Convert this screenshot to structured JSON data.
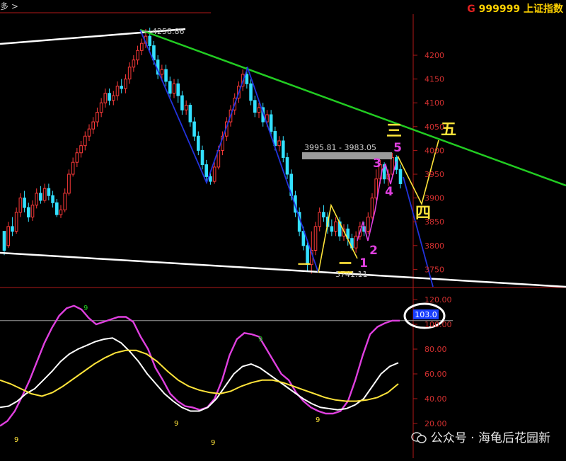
{
  "header": {
    "left_fragment": "多 >",
    "right_flag": "G",
    "code": "999999",
    "name": "上证指数"
  },
  "watermark": "公众号 · 海龟后花园新",
  "colors": {
    "up": "#ff3a3a",
    "down": "#33e0ff",
    "trend_green": "#22cc22",
    "trend_white": "#ffffff",
    "wave_blue": "#2233dd",
    "wave_yellow": "#ffe43a",
    "wave_magenta": "#e040e0",
    "axis_red": "#b01818"
  },
  "chart_data": [
    {
      "type": "candlestick",
      "title": "",
      "y_ticks": [
        3750,
        3800,
        3850,
        3900,
        3950,
        4000,
        4050,
        4100,
        4150,
        4200
      ],
      "ylim": [
        3705,
        4255
      ],
      "high_label": "4258.86",
      "low_label": "3741.11",
      "range_label": "3995.81 - 3983.05",
      "candles": [
        [
          3830,
          3790,
          3830,
          3780
        ],
        [
          3800,
          3840,
          3850,
          3795
        ],
        [
          3840,
          3830,
          3860,
          3820
        ],
        [
          3830,
          3870,
          3880,
          3825
        ],
        [
          3870,
          3900,
          3910,
          3860
        ],
        [
          3900,
          3880,
          3915,
          3870
        ],
        [
          3880,
          3860,
          3890,
          3850
        ],
        [
          3860,
          3885,
          3895,
          3852
        ],
        [
          3885,
          3910,
          3920,
          3878
        ],
        [
          3910,
          3895,
          3925,
          3888
        ],
        [
          3895,
          3920,
          3930,
          3890
        ],
        [
          3920,
          3905,
          3930,
          3895
        ],
        [
          3905,
          3890,
          3915,
          3880
        ],
        [
          3890,
          3865,
          3898,
          3860
        ],
        [
          3865,
          3875,
          3885,
          3858
        ],
        [
          3875,
          3910,
          3920,
          3870
        ],
        [
          3910,
          3950,
          3960,
          3905
        ],
        [
          3950,
          3975,
          3985,
          3945
        ],
        [
          3975,
          3995,
          4005,
          3965
        ],
        [
          3995,
          4010,
          4020,
          3985
        ],
        [
          4010,
          4030,
          4040,
          4000
        ],
        [
          4030,
          4045,
          4055,
          4020
        ],
        [
          4045,
          4060,
          4070,
          4035
        ],
        [
          4060,
          4080,
          4090,
          4050
        ],
        [
          4080,
          4100,
          4110,
          4070
        ],
        [
          4100,
          4120,
          4130,
          4090
        ],
        [
          4120,
          4105,
          4130,
          4095
        ],
        [
          4105,
          4115,
          4125,
          4095
        ],
        [
          4115,
          4135,
          4145,
          4105
        ],
        [
          4135,
          4130,
          4150,
          4120
        ],
        [
          4130,
          4150,
          4160,
          4120
        ],
        [
          4150,
          4175,
          4185,
          4140
        ],
        [
          4175,
          4190,
          4200,
          4165
        ],
        [
          4190,
          4210,
          4220,
          4180
        ],
        [
          4210,
          4225,
          4235,
          4200
        ],
        [
          4225,
          4240,
          4255,
          4215
        ],
        [
          4240,
          4220,
          4258,
          4210
        ],
        [
          4220,
          4190,
          4230,
          4180
        ],
        [
          4190,
          4160,
          4200,
          4150
        ],
        [
          4160,
          4170,
          4180,
          4145
        ],
        [
          4170,
          4145,
          4180,
          4135
        ],
        [
          4145,
          4120,
          4155,
          4110
        ],
        [
          4120,
          4140,
          4150,
          4110
        ],
        [
          4140,
          4115,
          4150,
          4100
        ],
        [
          4115,
          4085,
          4125,
          4075
        ],
        [
          4085,
          4095,
          4105,
          4075
        ],
        [
          4095,
          4060,
          4100,
          4050
        ],
        [
          4060,
          4030,
          4070,
          4020
        ],
        [
          4030,
          4000,
          4040,
          3990
        ],
        [
          4000,
          3970,
          4010,
          3960
        ],
        [
          3970,
          3945,
          3980,
          3935
        ],
        [
          3945,
          3935,
          3955,
          3928
        ],
        [
          3935,
          3965,
          3975,
          3930
        ],
        [
          3965,
          4000,
          4010,
          3960
        ],
        [
          4000,
          4030,
          4040,
          3990
        ],
        [
          4030,
          4060,
          4070,
          4020
        ],
        [
          4060,
          4085,
          4095,
          4050
        ],
        [
          4085,
          4110,
          4120,
          4075
        ],
        [
          4110,
          4135,
          4145,
          4100
        ],
        [
          4135,
          4160,
          4170,
          4125
        ],
        [
          4160,
          4140,
          4175,
          4130
        ],
        [
          4140,
          4105,
          4150,
          4095
        ],
        [
          4105,
          4080,
          4115,
          4070
        ],
        [
          4080,
          4090,
          4100,
          4068
        ],
        [
          4090,
          4060,
          4100,
          4050
        ],
        [
          4060,
          4075,
          4085,
          4050
        ],
        [
          4075,
          4040,
          4085,
          4030
        ],
        [
          4040,
          4010,
          4050,
          4000
        ],
        [
          4010,
          4020,
          4030,
          3998
        ],
        [
          4020,
          3985,
          4030,
          3975
        ],
        [
          3985,
          3950,
          3995,
          3940
        ],
        [
          3950,
          3905,
          3960,
          3895
        ],
        [
          3905,
          3870,
          3915,
          3860
        ],
        [
          3870,
          3830,
          3880,
          3820
        ],
        [
          3830,
          3800,
          3840,
          3790
        ],
        [
          3800,
          3760,
          3810,
          3745
        ],
        [
          3760,
          3790,
          3830,
          3741
        ],
        [
          3790,
          3840,
          3850,
          3780
        ],
        [
          3840,
          3870,
          3880,
          3830
        ],
        [
          3870,
          3860,
          3885,
          3850
        ],
        [
          3860,
          3840,
          3870,
          3825
        ],
        [
          3840,
          3830,
          3855,
          3820
        ],
        [
          3830,
          3850,
          3860,
          3820
        ],
        [
          3850,
          3820,
          3860,
          3810
        ],
        [
          3820,
          3835,
          3845,
          3810
        ],
        [
          3835,
          3815,
          3845,
          3800
        ],
        [
          3815,
          3795,
          3825,
          3790
        ],
        [
          3795,
          3820,
          3830,
          3785
        ],
        [
          3820,
          3840,
          3850,
          3812
        ],
        [
          3840,
          3830,
          3850,
          3820
        ],
        [
          3830,
          3860,
          3870,
          3825
        ],
        [
          3860,
          3900,
          3910,
          3855
        ],
        [
          3900,
          3940,
          3960,
          3895
        ],
        [
          3940,
          3970,
          3980,
          3930
        ],
        [
          3970,
          3940,
          3975,
          3930
        ],
        [
          3940,
          3950,
          3960,
          3925
        ],
        [
          3950,
          3985,
          3995,
          3945
        ],
        [
          3985,
          3960,
          3990,
          3950
        ],
        [
          3960,
          3930,
          3970,
          3920
        ]
      ],
      "wave_labels": [
        {
          "text": "一",
          "color": "yellow"
        },
        {
          "text": "二",
          "color": "yellow"
        },
        {
          "text": "三",
          "color": "yellow"
        },
        {
          "text": "四",
          "color": "yellow"
        },
        {
          "text": "五",
          "color": "yellow"
        },
        {
          "text": "1",
          "color": "magenta"
        },
        {
          "text": "2",
          "color": "magenta"
        },
        {
          "text": "3",
          "color": "magenta"
        },
        {
          "text": "4",
          "color": "magenta"
        },
        {
          "text": "5",
          "color": "magenta"
        }
      ]
    },
    {
      "type": "line",
      "title": "",
      "y_ticks": [
        20,
        40,
        60,
        80,
        100,
        120
      ],
      "ylim": [
        10,
        125
      ],
      "current_value_label": "103.0",
      "reference_line": 103,
      "series": [
        {
          "color": "#e040e0",
          "values": [
            18,
            22,
            30,
            42,
            55,
            70,
            85,
            97,
            107,
            113,
            115,
            112,
            105,
            100,
            102,
            104,
            106,
            106,
            102,
            90,
            80,
            65,
            55,
            44,
            38,
            34,
            33,
            31,
            33,
            40,
            55,
            75,
            88,
            93,
            92,
            90,
            80,
            70,
            60,
            55,
            45,
            38,
            33,
            30,
            28,
            28,
            30,
            38,
            55,
            75,
            92,
            98,
            101,
            103,
            103
          ]
        },
        {
          "color": "#ffffff",
          "values": [
            33,
            34,
            38,
            44,
            48,
            55,
            62,
            70,
            76,
            80,
            83,
            86,
            88,
            89,
            85,
            78,
            70,
            60,
            52,
            44,
            38,
            33,
            30,
            30,
            33,
            40,
            50,
            60,
            66,
            68,
            65,
            60,
            55,
            50,
            45,
            40,
            36,
            33,
            32,
            31,
            32,
            35,
            40,
            50,
            60,
            66,
            69
          ]
        },
        {
          "color": "#ffe43a",
          "values": [
            55,
            52,
            48,
            44,
            42,
            45,
            50,
            56,
            62,
            68,
            73,
            77,
            79,
            79,
            76,
            70,
            62,
            55,
            50,
            47,
            45,
            44,
            46,
            50,
            53,
            55,
            55,
            53,
            50,
            47,
            44,
            41,
            39,
            38,
            38,
            39,
            41,
            45,
            52
          ]
        }
      ]
    }
  ]
}
